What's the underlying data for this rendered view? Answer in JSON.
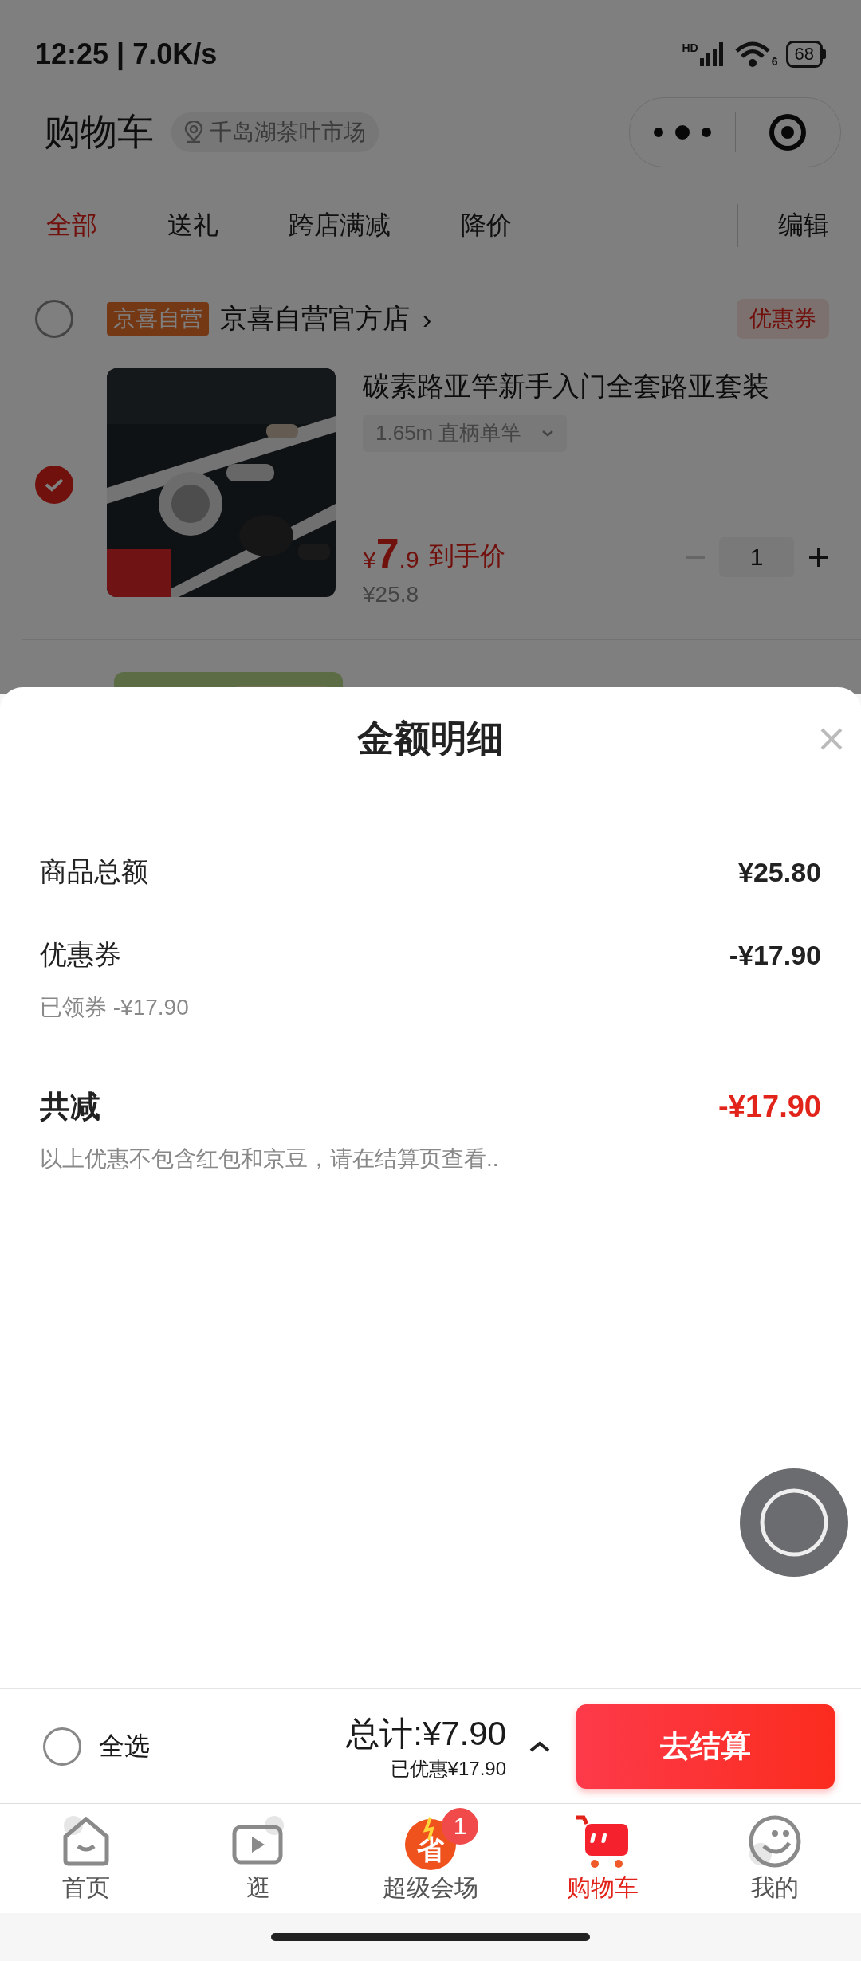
{
  "status_bar": {
    "time": "12:25 | 7.0K/s",
    "signal_label": "HD",
    "wifi_label": "6",
    "battery": "68"
  },
  "header": {
    "title": "购物车",
    "location": "千岛湖茶叶市场"
  },
  "filter_tabs": [
    {
      "label": "全部",
      "selected": true
    },
    {
      "label": "送礼",
      "selected": false
    },
    {
      "label": "跨店满减",
      "selected": false
    },
    {
      "label": "降价",
      "selected": false
    }
  ],
  "edit": "编辑",
  "store": {
    "badge": "京喜自营",
    "name": "京喜自营官方店",
    "chevron": "›",
    "coupon": "优惠券",
    "checked": false
  },
  "product": {
    "title": "碳素路亚竿新手入门全套路亚套装",
    "spec": "1.65m 直柄单竿",
    "price_symbol": "¥",
    "price_int": "7",
    "price_dec": ".9",
    "price_note": "到手价",
    "original_price": "¥25.8",
    "quantity": "1",
    "checked": true
  },
  "sheet": {
    "title": "金额明细",
    "rows": [
      {
        "kind": "amount",
        "label": "商品总额",
        "value": "¥25.80"
      },
      {
        "kind": "amount",
        "label": "优惠券",
        "value": "-¥17.90",
        "sub": "已领券 -¥17.90"
      },
      {
        "kind": "total",
        "label": "共减",
        "value": "-¥17.90",
        "sub": "以上优惠不包含红包和京豆，请在结算页查看.."
      }
    ]
  },
  "checkout": {
    "select_all": "全选",
    "checked": false,
    "total": "总计:¥7.90",
    "saved": "已优惠¥17.90",
    "button": "去结算"
  },
  "tab_bar": [
    {
      "label": "首页",
      "selected": false
    },
    {
      "label": "逛",
      "selected": false
    },
    {
      "label": "超级会场",
      "selected": false,
      "icon_text": "省",
      "badge": "1"
    },
    {
      "label": "购物车",
      "selected": true
    },
    {
      "label": "我的",
      "selected": false
    }
  ]
}
